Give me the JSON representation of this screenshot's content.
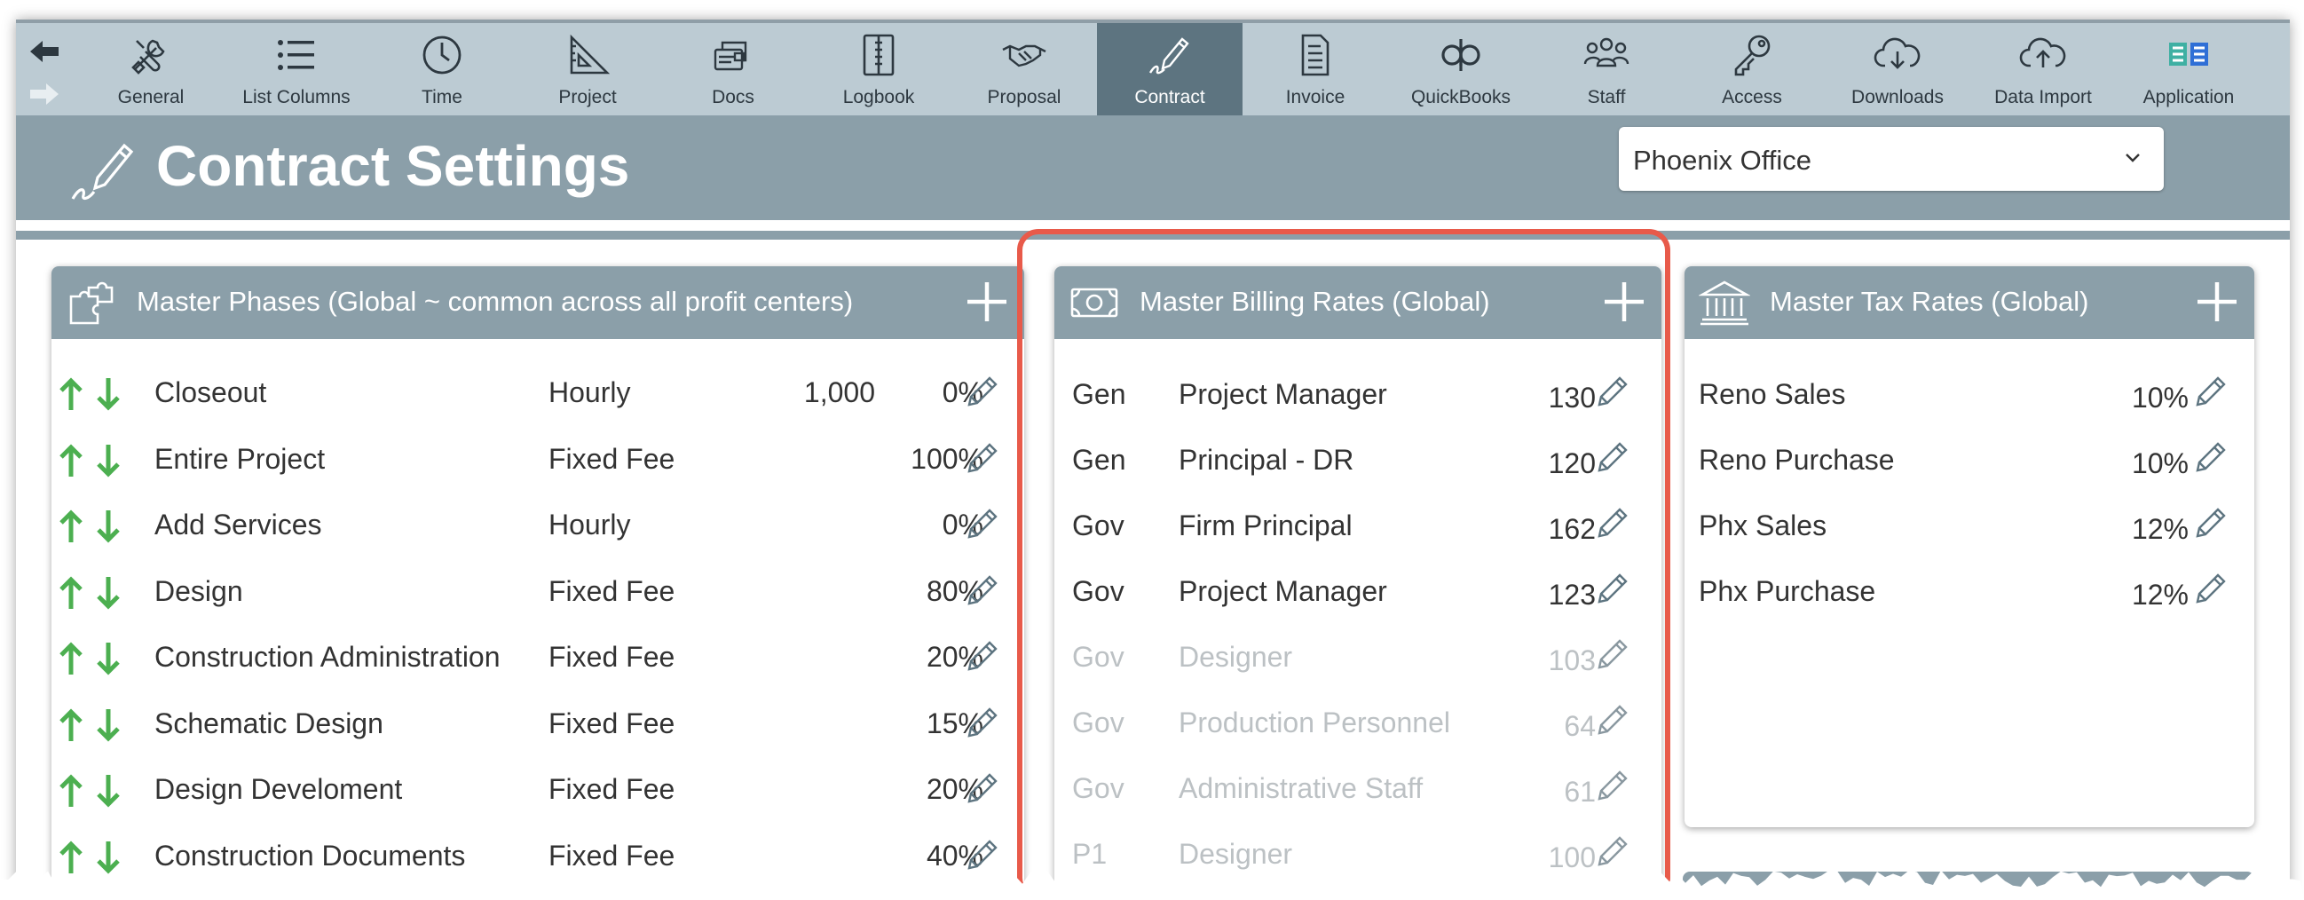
{
  "toolbar": {
    "tabs": [
      {
        "label": "General",
        "icon": "tools-icon"
      },
      {
        "label": "List Columns",
        "icon": "list-icon"
      },
      {
        "label": "Time",
        "icon": "clock-icon"
      },
      {
        "label": "Project",
        "icon": "set-square-icon"
      },
      {
        "label": "Docs",
        "icon": "documents-icon"
      },
      {
        "label": "Logbook",
        "icon": "logbook-icon"
      },
      {
        "label": "Proposal",
        "icon": "handshake-icon"
      },
      {
        "label": "Contract",
        "icon": "signature-pen-icon",
        "active": true
      },
      {
        "label": "Invoice",
        "icon": "invoice-icon"
      },
      {
        "label": "QuickBooks",
        "icon": "quickbooks-icon"
      },
      {
        "label": "Staff",
        "icon": "staff-icon"
      },
      {
        "label": "Access",
        "icon": "key-icon"
      },
      {
        "label": "Downloads",
        "icon": "cloud-download-icon"
      },
      {
        "label": "Data Import",
        "icon": "cloud-upload-icon"
      },
      {
        "label": "Application",
        "icon": "application-logo-icon"
      }
    ]
  },
  "header": {
    "title": "Contract Settings",
    "office_select": "Phoenix Office"
  },
  "phases": {
    "title": "Master Phases (Global ~ common across all profit centers)",
    "rows": [
      {
        "name": "Closeout",
        "type": "Hourly",
        "amount": "1,000",
        "pct": "0%"
      },
      {
        "name": "Entire Project",
        "type": "Fixed Fee",
        "amount": "",
        "pct": "100%"
      },
      {
        "name": "Add Services",
        "type": "Hourly",
        "amount": "",
        "pct": "0%"
      },
      {
        "name": "Design",
        "type": "Fixed Fee",
        "amount": "",
        "pct": "80%"
      },
      {
        "name": "Construction Administration",
        "type": "Fixed Fee",
        "amount": "",
        "pct": "20%"
      },
      {
        "name": "Schematic Design",
        "type": "Fixed Fee",
        "amount": "",
        "pct": "15%"
      },
      {
        "name": "Design Develoment",
        "type": "Fixed Fee",
        "amount": "",
        "pct": "20%"
      },
      {
        "name": "Construction Documents",
        "type": "Fixed Fee",
        "amount": "",
        "pct": "40%"
      }
    ]
  },
  "billing": {
    "title": "Master Billing Rates (Global)",
    "rows": [
      {
        "code": "Gen",
        "role": "Project Manager",
        "rate": "130",
        "dim": false
      },
      {
        "code": "Gen",
        "role": "Principal - DR",
        "rate": "120",
        "dim": false
      },
      {
        "code": "Gov",
        "role": "Firm Principal",
        "rate": "162",
        "dim": false
      },
      {
        "code": "Gov",
        "role": "Project Manager",
        "rate": "123",
        "dim": false
      },
      {
        "code": "Gov",
        "role": "Designer",
        "rate": "103",
        "dim": true
      },
      {
        "code": "Gov",
        "role": "Production Personnel",
        "rate": "64",
        "dim": true
      },
      {
        "code": "Gov",
        "role": "Administrative Staff",
        "rate": "61",
        "dim": true
      },
      {
        "code": "P1",
        "role": "Designer",
        "rate": "100",
        "dim": true
      }
    ]
  },
  "tax": {
    "title": "Master Tax Rates (Global)",
    "rows": [
      {
        "name": "Reno Sales",
        "rate": "10%"
      },
      {
        "name": "Reno Purchase",
        "rate": "10%"
      },
      {
        "name": "Phx Sales",
        "rate": "12%"
      },
      {
        "name": "Phx Purchase",
        "rate": "12%"
      }
    ]
  },
  "colors": {
    "toolbar": "#bccbd3",
    "active_tab": "#5d7480",
    "header": "#8b9fa9",
    "arrow_green": "#4caf50",
    "highlight": "#e85a4a"
  }
}
